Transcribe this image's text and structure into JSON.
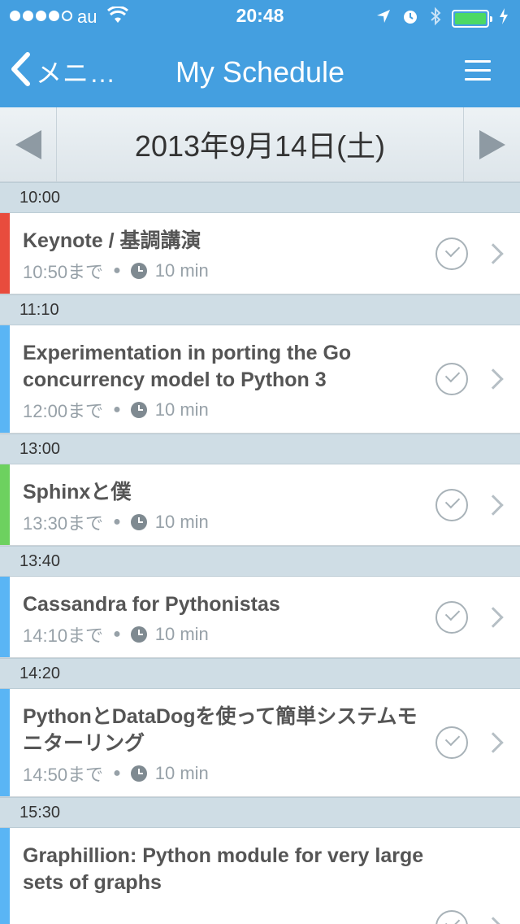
{
  "status_bar": {
    "carrier": "au",
    "time": "20:48"
  },
  "nav": {
    "back_label": "メニ…",
    "title": "My Schedule"
  },
  "date_bar": {
    "date": "2013年9月14日(土)"
  },
  "colors": {
    "nav_bg": "#449fe0",
    "red": "#e84c3d",
    "blue": "#5ab5f5",
    "green": "#6dd15f"
  },
  "sessions": [
    {
      "start": "10:00",
      "title": "Keynote / 基調講演",
      "until": "10:50まで",
      "duration": "10 min",
      "color": "#e84c3d"
    },
    {
      "start": "11:10",
      "title": "Experimentation in porting the Go concurrency model to Python 3",
      "until": "12:00まで",
      "duration": "10 min",
      "color": "#5ab5f5"
    },
    {
      "start": "13:00",
      "title": "Sphinxと僕",
      "until": "13:30まで",
      "duration": "10 min",
      "color": "#6dd15f"
    },
    {
      "start": "13:40",
      "title": "Cassandra for Pythonistas",
      "until": "14:10まで",
      "duration": "10 min",
      "color": "#5ab5f5"
    },
    {
      "start": "14:20",
      "title": "PythonとDataDogを使って簡単システムモニターリング",
      "until": "14:50まで",
      "duration": "10 min",
      "color": "#5ab5f5"
    },
    {
      "start": "15:30",
      "title": "Graphillion: Python module for very large sets of graphs",
      "until": "",
      "duration": "",
      "color": "#5ab5f5"
    }
  ]
}
